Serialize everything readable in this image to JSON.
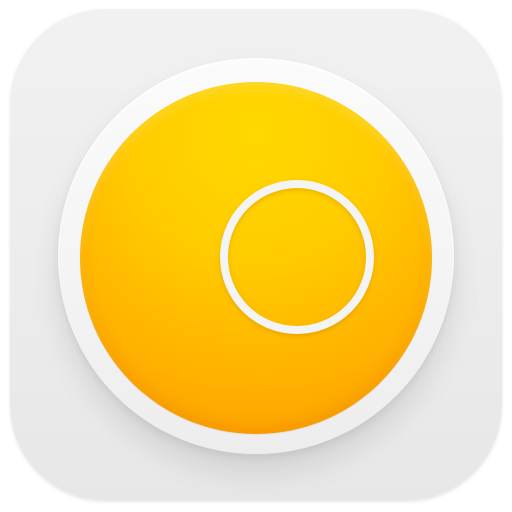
{
  "app_icon": {
    "name": "record-button-app-icon",
    "colors": {
      "tile_background": "#ececec",
      "outer_ring": "#f6f6f6",
      "core_top": "#ffd800",
      "core_bottom": "#ff9a00",
      "indicator_ring": "#f4f4f4"
    },
    "icons": {
      "center": "record-dot-icon"
    }
  }
}
